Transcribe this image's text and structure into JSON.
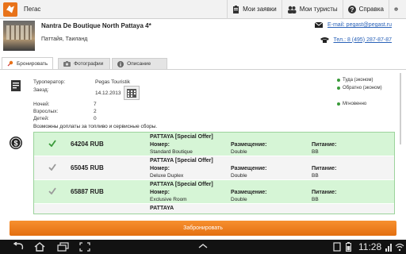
{
  "actionbar": {
    "title": "Пегас",
    "my_orders": "Мои заявки",
    "my_tourists": "Мои туристы",
    "help": "Справка"
  },
  "hotel": {
    "name": "Nantra De Boutique North Pattaya 4*",
    "location": "Паттайя, Таиланд",
    "email": "E-mail: pegast@pegast.ru",
    "phone": "Тел.: 8 (495) 287-87-87"
  },
  "tabs": [
    {
      "label": "Бронировать",
      "icon": "pin-icon"
    },
    {
      "label": "Фотографии",
      "icon": "camera-icon"
    },
    {
      "label": "Описание",
      "icon": "info-icon"
    }
  ],
  "details": {
    "operator_label": "Туроператор:",
    "operator_value": "Pegas Touristik",
    "arrival_label": "Заезд:",
    "arrival_value": "14.12.2013",
    "nights_label": "Ночей:",
    "nights_value": "7",
    "adults_label": "Взрослых:",
    "adults_value": "2",
    "children_label": "Детей:",
    "children_value": "0",
    "flight_there": "Туда (эконом)",
    "flight_back": "Обратно (эконом)",
    "instant": "Мгновенно",
    "fuel_note": "Возможны доплаты за топливо и сервисные сборы."
  },
  "offer_headers": {
    "room": "Номер:",
    "accommodation": "Размещение:",
    "meal": "Питание:"
  },
  "offers": [
    {
      "price": "64204 RUB",
      "title": "PATTAYA [Special Offer]",
      "room": "Standard Boutique",
      "accommodation": "Double",
      "meal": "BB"
    },
    {
      "price": "65045 RUB",
      "title": "PATTAYA [Special Offer]",
      "room": "Deluxe Duplex",
      "accommodation": "Double",
      "meal": "BB"
    },
    {
      "price": "65887 RUB",
      "title": "PATTAYA [Special Offer]",
      "room": "Exclusive Room",
      "accommodation": "Double",
      "meal": "BB"
    },
    {
      "price": "",
      "title": "PATTAYA",
      "room": "",
      "accommodation": "",
      "meal": ""
    }
  ],
  "book_button": "Забронировать",
  "status": {
    "time": "11:28"
  },
  "colors": {
    "accent": "#e8731a",
    "link": "#2a62b8",
    "offer_green": "#d6f5d6"
  }
}
